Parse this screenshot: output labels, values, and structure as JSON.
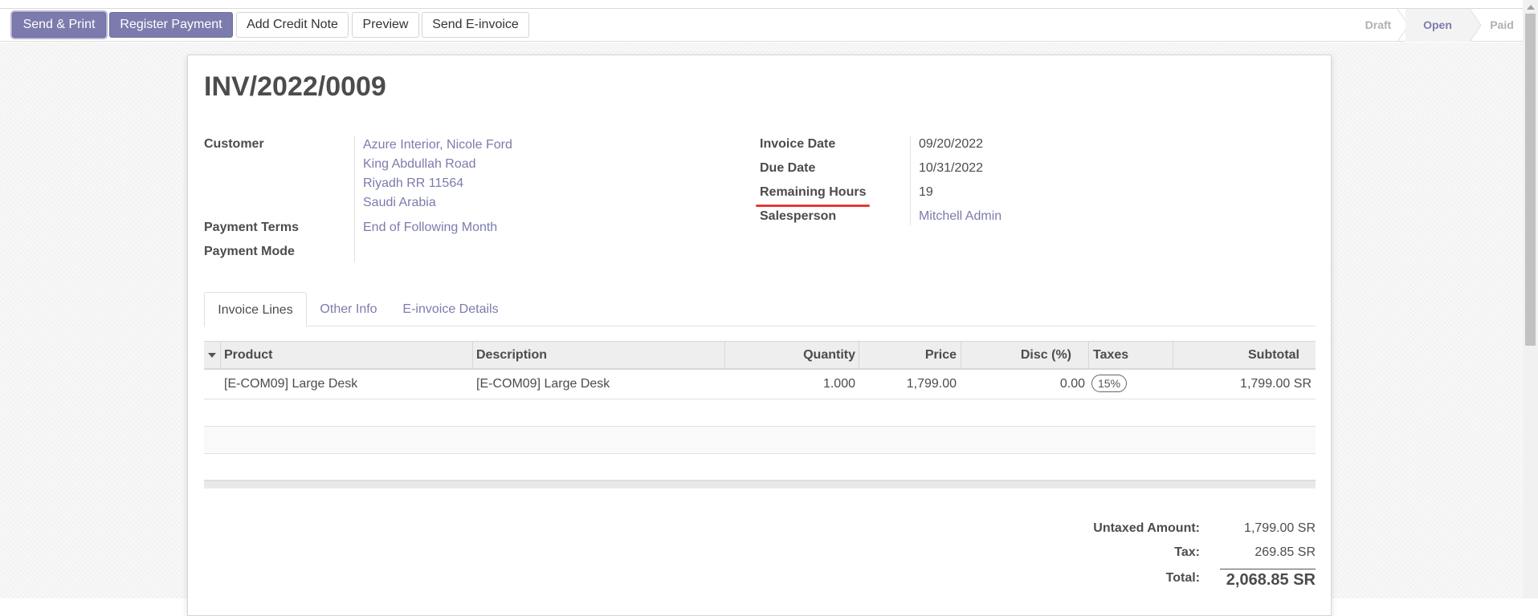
{
  "toolbar": {
    "send_print": "Send & Print",
    "register_payment": "Register Payment",
    "add_credit_note": "Add Credit Note",
    "preview": "Preview",
    "send_einvoice": "Send E-invoice"
  },
  "status": {
    "stages": [
      "Draft",
      "Open",
      "Paid"
    ],
    "active": "Open"
  },
  "invoice": {
    "name": "INV/2022/0009",
    "customer_label": "Customer",
    "customer_name": "Azure Interior, Nicole Ford",
    "address": [
      "King Abdullah Road",
      "Riyadh RR 11564",
      "Saudi Arabia"
    ],
    "payment_terms_label": "Payment Terms",
    "payment_terms": "End of Following Month",
    "payment_mode_label": "Payment Mode",
    "payment_mode": "",
    "invoice_date_label": "Invoice Date",
    "invoice_date": "09/20/2022",
    "due_date_label": "Due Date",
    "due_date": "10/31/2022",
    "remaining_hours_label": "Remaining Hours",
    "remaining_hours": "19",
    "salesperson_label": "Salesperson",
    "salesperson": "Mitchell Admin"
  },
  "tabs": [
    "Invoice Lines",
    "Other Info",
    "E-invoice Details"
  ],
  "lines": {
    "headers": [
      "Product",
      "Description",
      "Quantity",
      "Price",
      "Disc (%)",
      "Taxes",
      "Subtotal"
    ],
    "rows": [
      {
        "product": "[E-COM09] Large Desk",
        "description": "[E-COM09] Large Desk",
        "quantity": "1.000",
        "price": "1,799.00",
        "discount": "0.00",
        "taxes": "15%",
        "subtotal": "1,799.00 SR"
      }
    ]
  },
  "totals": {
    "untaxed_label": "Untaxed Amount:",
    "untaxed": "1,799.00 SR",
    "tax_label": "Tax:",
    "tax": "269.85 SR",
    "total_label": "Total:",
    "total": "2,068.85 SR"
  },
  "colors": {
    "primary": "#7c7bad",
    "underline": "#e53935"
  }
}
